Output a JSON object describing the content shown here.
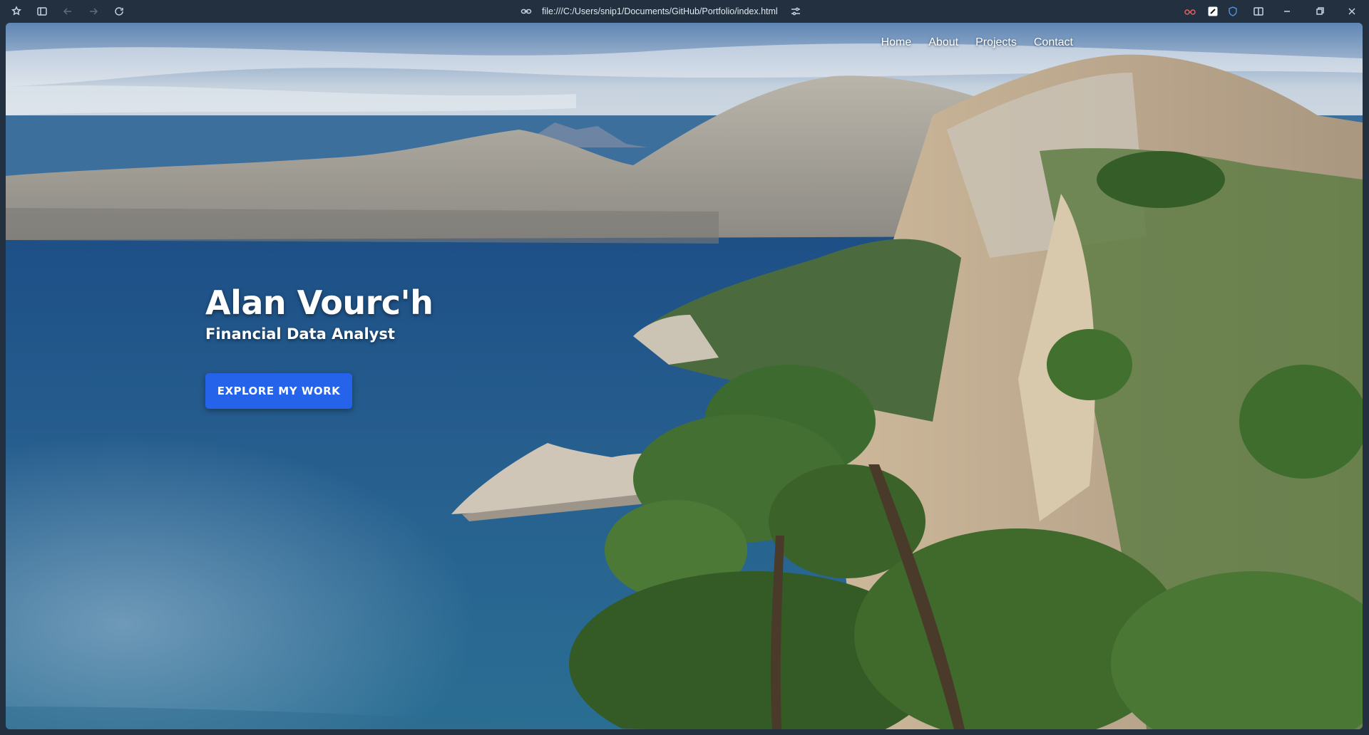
{
  "browser": {
    "url": "file:///C:/Users/snip1/Documents/GitHub/Portfolio/index.html",
    "icons": {
      "workspaces": "workspaces-icon",
      "sidebar": "sidebar-toggle-icon",
      "back": "back-arrow-icon",
      "forward": "forward-arrow-icon",
      "refresh": "refresh-icon",
      "link": "link-icon",
      "site_settings": "site-settings-icon",
      "extensions": [
        "extension-glasses-icon",
        "extension-pen-icon",
        "extension-shield-icon"
      ],
      "split": "split-screen-icon",
      "minimize": "minimize-icon",
      "maximize": "restore-icon",
      "close": "close-icon"
    }
  },
  "nav": {
    "items": [
      "Home",
      "About",
      "Projects",
      "Contact"
    ]
  },
  "hero": {
    "name": "Alan Vourc'h",
    "title": "Financial Data Analyst",
    "cta": "EXPLORE MY WORK"
  },
  "colors": {
    "accent": "#2563eb",
    "chrome": "#22303f"
  }
}
